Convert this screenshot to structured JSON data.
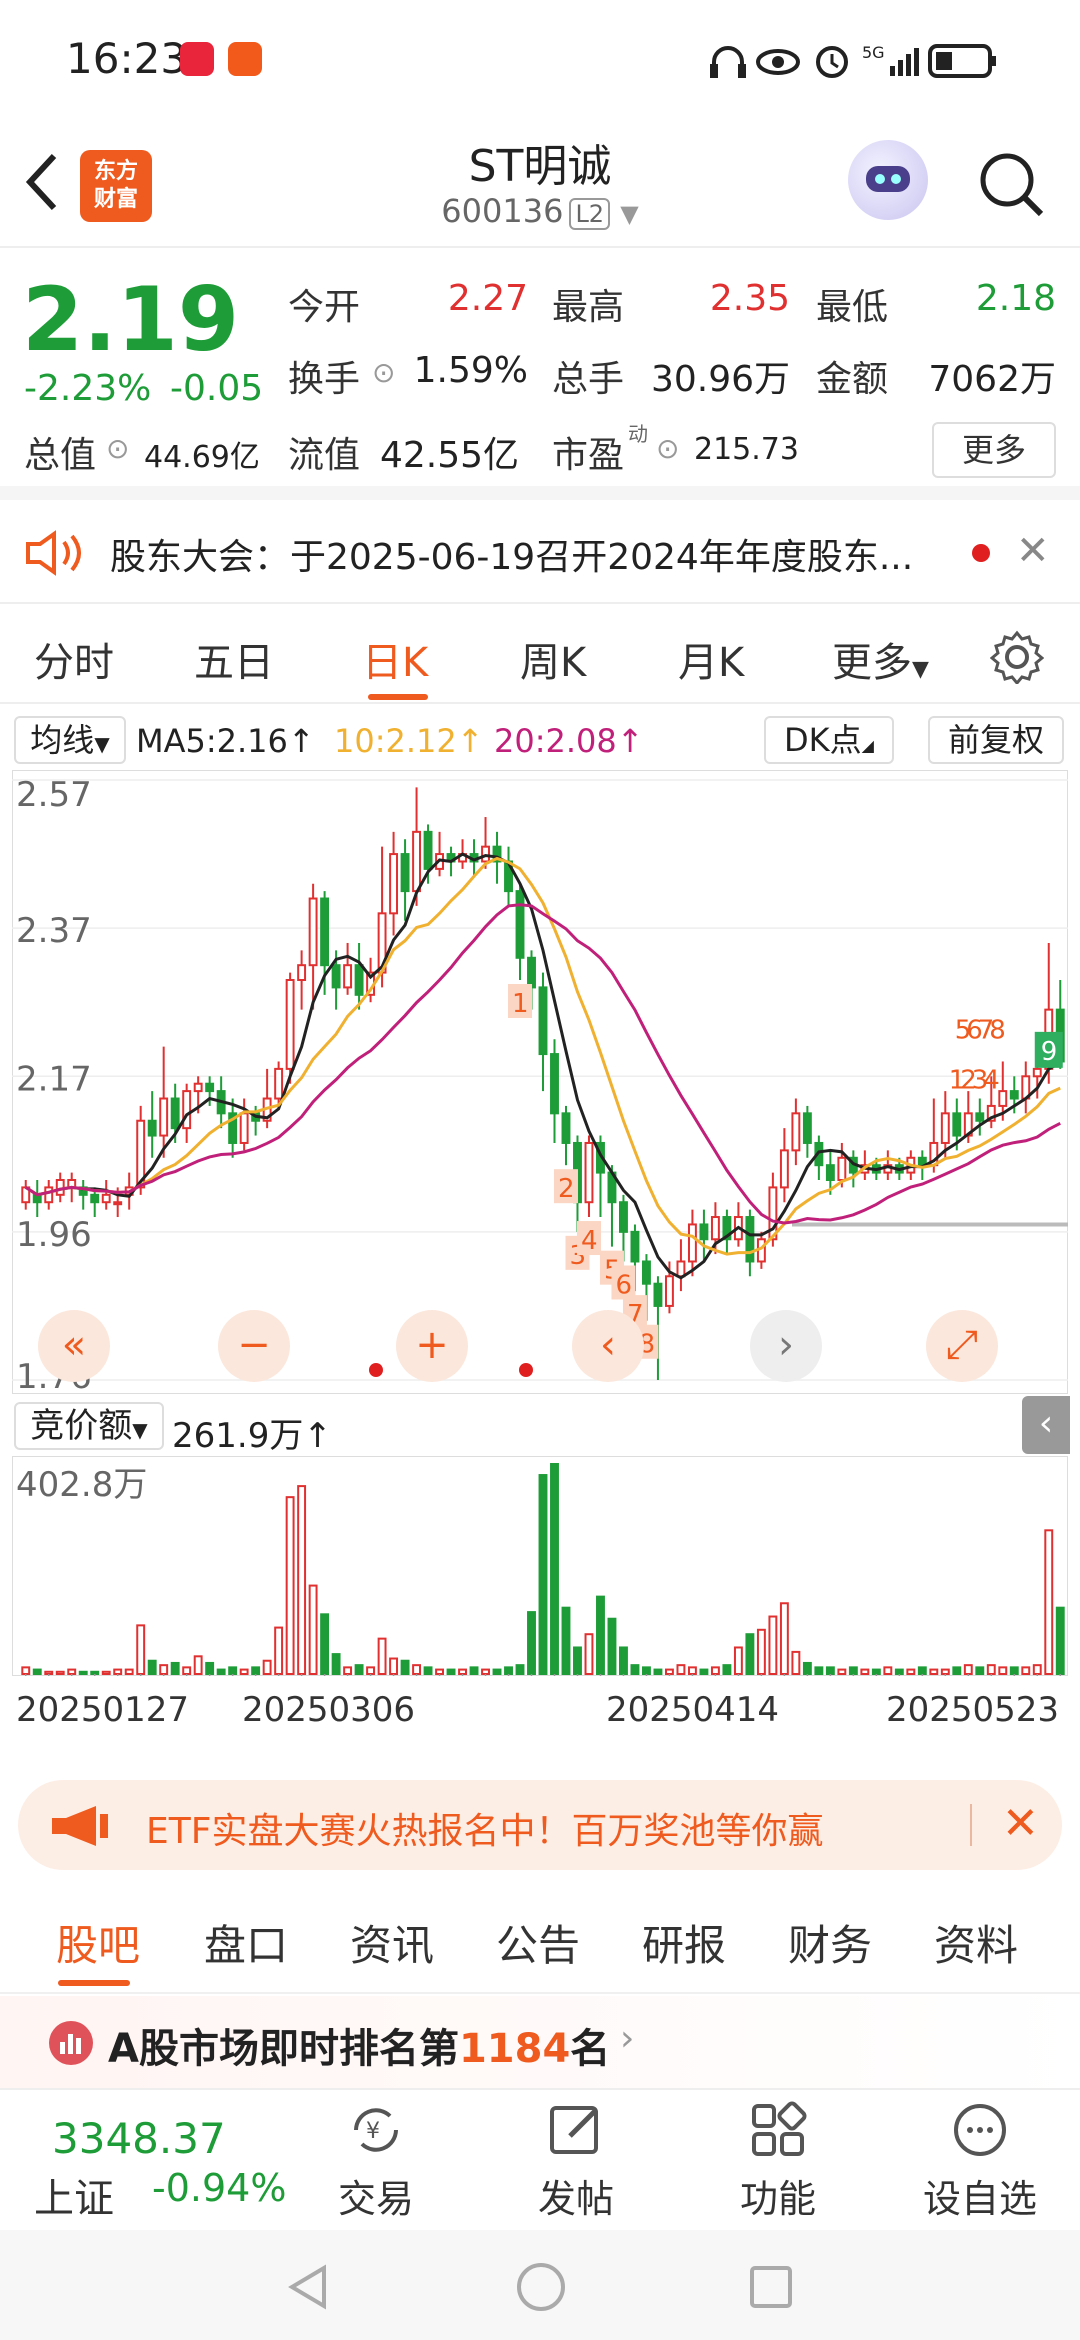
{
  "status": {
    "time": "16:23"
  },
  "header": {
    "title": "ST明诚",
    "code": "600136",
    "level": "L2",
    "logo_text": "东方财富"
  },
  "quote": {
    "price": "2.19",
    "pct": "-2.23%",
    "change": "-0.05",
    "fields": [
      {
        "label": "今开",
        "value": "2.27",
        "color": "red"
      },
      {
        "label": "最高",
        "value": "2.35",
        "color": "red"
      },
      {
        "label": "最低",
        "value": "2.18",
        "color": "green"
      },
      {
        "label": "换手",
        "value": "1.59%",
        "color": "black"
      },
      {
        "label": "总手",
        "value": "30.96万",
        "color": "black"
      },
      {
        "label": "金额",
        "value": "7062万",
        "color": "black"
      },
      {
        "label": "总值",
        "value": "44.69亿",
        "color": "black"
      },
      {
        "label": "流值",
        "value": "42.55亿",
        "color": "black"
      },
      {
        "label": "市盈",
        "value": "215.73",
        "color": "black"
      }
    ],
    "pe_sup": "动",
    "more": "更多"
  },
  "notice": {
    "text": "股东大会：于2025-06-19召开2024年年度股东..."
  },
  "tabs": [
    "分时",
    "五日",
    "日K",
    "周K",
    "月K",
    "更多"
  ],
  "ma": {
    "avg_label": "均线",
    "ma5": "MA5:2.16↑",
    "ma10": "10:2.12↑",
    "ma20": "20:2.08↑",
    "dk": "DK点",
    "adjust": "前复权"
  },
  "price_axis": [
    "2.57",
    "2.37",
    "2.17",
    "1.96",
    "1.76"
  ],
  "volume": {
    "label": "竞价额",
    "value": "261.9万↑",
    "max": "402.8万"
  },
  "dates": [
    "20250127",
    "20250306",
    "20250414",
    "20250523"
  ],
  "banner": {
    "text": "ETF实盘大赛火热报名中！百万奖池等你赢"
  },
  "subtabs": [
    "股吧",
    "盘口",
    "资讯",
    "公告",
    "研报",
    "财务",
    "资料"
  ],
  "rank": {
    "prefix": "A股市场即时排名第",
    "num": "1184",
    "suffix": "名"
  },
  "index": {
    "value": "3348.37",
    "name": "上证",
    "pct": "-0.94%"
  },
  "nav": [
    "交易",
    "发帖",
    "功能",
    "设自选"
  ],
  "colors": {
    "up": "#e03030",
    "down": "#1d9c37",
    "accent": "#ef5a1f",
    "ma5": "#222222",
    "ma10": "#f0b030",
    "ma20": "#c0207a"
  },
  "chart_data": {
    "type": "candlestick",
    "ylim": [
      1.76,
      2.57
    ],
    "candles": [
      [
        2.0,
        2.02,
        1.99,
        2.03
      ],
      [
        2.01,
        2.0,
        1.98,
        2.03
      ],
      [
        2.0,
        2.02,
        1.99,
        2.03
      ],
      [
        2.01,
        2.03,
        2.0,
        2.04
      ],
      [
        2.02,
        2.03,
        2.0,
        2.04
      ],
      [
        2.02,
        2.01,
        1.99,
        2.03
      ],
      [
        2.01,
        2.0,
        1.98,
        2.02
      ],
      [
        2.0,
        2.01,
        1.99,
        2.03
      ],
      [
        2.0,
        2.0,
        1.98,
        2.02
      ],
      [
        2.01,
        2.02,
        1.99,
        2.04
      ],
      [
        2.02,
        2.11,
        2.01,
        2.13
      ],
      [
        2.11,
        2.09,
        2.06,
        2.15
      ],
      [
        2.09,
        2.14,
        2.06,
        2.21
      ],
      [
        2.14,
        2.1,
        2.08,
        2.16
      ],
      [
        2.1,
        2.15,
        2.08,
        2.16
      ],
      [
        2.15,
        2.16,
        2.12,
        2.17
      ],
      [
        2.16,
        2.15,
        2.13,
        2.17
      ],
      [
        2.15,
        2.12,
        2.1,
        2.17
      ],
      [
        2.12,
        2.08,
        2.06,
        2.14
      ],
      [
        2.08,
        2.12,
        2.07,
        2.14
      ],
      [
        2.12,
        2.11,
        2.09,
        2.13
      ],
      [
        2.11,
        2.14,
        2.1,
        2.18
      ],
      [
        2.14,
        2.18,
        2.13,
        2.19
      ],
      [
        2.18,
        2.3,
        2.16,
        2.31
      ],
      [
        2.3,
        2.32,
        2.26,
        2.34
      ],
      [
        2.32,
        2.41,
        2.26,
        2.43
      ],
      [
        2.41,
        2.32,
        2.28,
        2.42
      ],
      [
        2.32,
        2.29,
        2.26,
        2.34
      ],
      [
        2.29,
        2.32,
        2.28,
        2.35
      ],
      [
        2.32,
        2.28,
        2.26,
        2.35
      ],
      [
        2.28,
        2.31,
        2.27,
        2.33
      ],
      [
        2.31,
        2.39,
        2.29,
        2.48
      ],
      [
        2.39,
        2.47,
        2.36,
        2.5
      ],
      [
        2.47,
        2.42,
        2.38,
        2.49
      ],
      [
        2.42,
        2.5,
        2.4,
        2.56
      ],
      [
        2.5,
        2.45,
        2.43,
        2.51
      ],
      [
        2.45,
        2.47,
        2.44,
        2.5
      ],
      [
        2.47,
        2.46,
        2.44,
        2.48
      ],
      [
        2.46,
        2.47,
        2.45,
        2.49
      ],
      [
        2.47,
        2.46,
        2.44,
        2.49
      ],
      [
        2.46,
        2.48,
        2.45,
        2.52
      ],
      [
        2.48,
        2.46,
        2.43,
        2.5
      ],
      [
        2.46,
        2.42,
        2.4,
        2.48
      ],
      [
        2.42,
        2.33,
        2.3,
        2.43
      ],
      [
        2.33,
        2.29,
        2.26,
        2.34
      ],
      [
        2.29,
        2.2,
        2.15,
        2.31
      ],
      [
        2.2,
        2.12,
        2.08,
        2.22
      ],
      [
        2.12,
        2.08,
        2.05,
        2.13
      ],
      [
        2.08,
        2.0,
        1.96,
        2.09
      ],
      [
        2.0,
        2.08,
        1.98,
        2.09
      ],
      [
        2.08,
        2.04,
        1.98,
        2.09
      ],
      [
        2.04,
        2.0,
        1.94,
        2.05
      ],
      [
        2.0,
        1.96,
        1.92,
        2.01
      ],
      [
        1.96,
        1.92,
        1.88,
        1.97
      ],
      [
        1.92,
        1.89,
        1.84,
        1.93
      ],
      [
        1.89,
        1.86,
        1.76,
        1.9
      ],
      [
        1.86,
        1.9,
        1.85,
        1.92
      ],
      [
        1.9,
        1.92,
        1.88,
        1.95
      ],
      [
        1.92,
        1.97,
        1.9,
        1.99
      ],
      [
        1.97,
        1.95,
        1.92,
        1.99
      ],
      [
        1.95,
        1.98,
        1.93,
        2.0
      ],
      [
        1.98,
        1.95,
        1.93,
        1.99
      ],
      [
        1.95,
        1.98,
        1.94,
        2.0
      ],
      [
        1.98,
        1.92,
        1.9,
        1.99
      ],
      [
        1.92,
        1.95,
        1.91,
        1.96
      ],
      [
        1.95,
        2.02,
        1.94,
        2.04
      ],
      [
        2.02,
        2.07,
        2.0,
        2.1
      ],
      [
        2.07,
        2.12,
        2.05,
        2.14
      ],
      [
        2.12,
        2.08,
        2.06,
        2.13
      ],
      [
        2.08,
        2.05,
        2.03,
        2.09
      ],
      [
        2.05,
        2.03,
        2.01,
        2.07
      ],
      [
        2.03,
        2.06,
        2.02,
        2.08
      ],
      [
        2.06,
        2.04,
        2.02,
        2.07
      ],
      [
        2.04,
        2.05,
        2.03,
        2.07
      ],
      [
        2.05,
        2.04,
        2.03,
        2.06
      ],
      [
        2.04,
        2.05,
        2.03,
        2.07
      ],
      [
        2.05,
        2.04,
        2.03,
        2.06
      ],
      [
        2.04,
        2.06,
        2.03,
        2.07
      ],
      [
        2.06,
        2.05,
        2.03,
        2.07
      ],
      [
        2.05,
        2.08,
        2.04,
        2.14
      ],
      [
        2.08,
        2.12,
        2.06,
        2.15
      ],
      [
        2.12,
        2.09,
        2.07,
        2.14
      ],
      [
        2.09,
        2.12,
        2.08,
        2.15
      ],
      [
        2.12,
        2.11,
        2.09,
        2.14
      ],
      [
        2.11,
        2.13,
        2.1,
        2.17
      ],
      [
        2.13,
        2.15,
        2.11,
        2.19
      ],
      [
        2.15,
        2.14,
        2.12,
        2.17
      ],
      [
        2.14,
        2.17,
        2.12,
        2.19
      ],
      [
        2.17,
        2.18,
        2.14,
        2.22
      ],
      [
        2.18,
        2.26,
        2.16,
        2.35
      ],
      [
        2.26,
        2.19,
        2.18,
        2.3
      ]
    ],
    "volumes": [
      3,
      2,
      1,
      1,
      2,
      1,
      1,
      1,
      2,
      2,
      22,
      6,
      4,
      5,
      3,
      8,
      5,
      2,
      3,
      2,
      3,
      6,
      21,
      80,
      85,
      40,
      27,
      9,
      3,
      4,
      3,
      16,
      7,
      6,
      4,
      3,
      2,
      2,
      2,
      3,
      2,
      2,
      3,
      4,
      28,
      90,
      95,
      30,
      12,
      18,
      35,
      25,
      12,
      4,
      3,
      2,
      2,
      4,
      3,
      2,
      3,
      4,
      12,
      18,
      20,
      26,
      32,
      10,
      5,
      3,
      3,
      2,
      3,
      2,
      2,
      3,
      2,
      2,
      3,
      2,
      2,
      3,
      4,
      3,
      4,
      3,
      3,
      3,
      4,
      65,
      30
    ],
    "ma_dk_markers": [
      [
        43,
        "1"
      ],
      [
        47,
        "2"
      ],
      [
        48,
        "3"
      ],
      [
        49,
        "4"
      ],
      [
        51,
        "5"
      ],
      [
        52,
        "6"
      ],
      [
        53,
        "7"
      ],
      [
        54,
        "8"
      ],
      [
        55,
        "9"
      ]
    ]
  }
}
